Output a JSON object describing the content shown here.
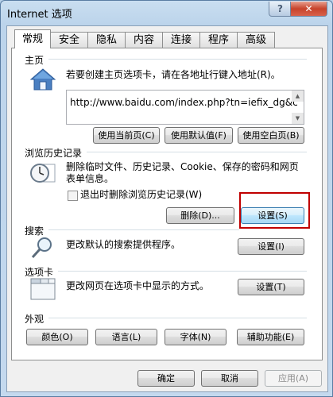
{
  "window": {
    "title": "Internet 选项",
    "help_label": "?",
    "close_label": "✕"
  },
  "tabs": [
    "常规",
    "安全",
    "隐私",
    "内容",
    "连接",
    "程序",
    "高级"
  ],
  "homepage": {
    "section_title": "主页",
    "description": "若要创建主页选项卡，请在各地址行键入地址(R)。",
    "url": "http://www.baidu.com/index.php?tn=iefix_dg&c",
    "buttons": {
      "use_current": "使用当前页(C)",
      "use_default": "使用默认值(F)",
      "use_blank": "使用空白页(B)"
    }
  },
  "history": {
    "section_title": "浏览历史记录",
    "description": "删除临时文件、历史记录、Cookie、保存的密码和网页表单信息。",
    "checkbox_label": "退出时删除浏览历史记录(W)",
    "delete_button": "删除(D)...",
    "settings_button": "设置(S)"
  },
  "search": {
    "section_title": "搜索",
    "description": "更改默认的搜索提供程序。",
    "settings_button": "设置(I)"
  },
  "tabs_section": {
    "section_title": "选项卡",
    "description": "更改网页在选项卡中显示的方式。",
    "settings_button": "设置(T)"
  },
  "appearance": {
    "section_title": "外观",
    "buttons": [
      "颜色(O)",
      "语言(L)",
      "字体(N)",
      "辅助功能(E)"
    ]
  },
  "footer": {
    "ok": "确定",
    "cancel": "取消",
    "apply": "应用(A)"
  }
}
